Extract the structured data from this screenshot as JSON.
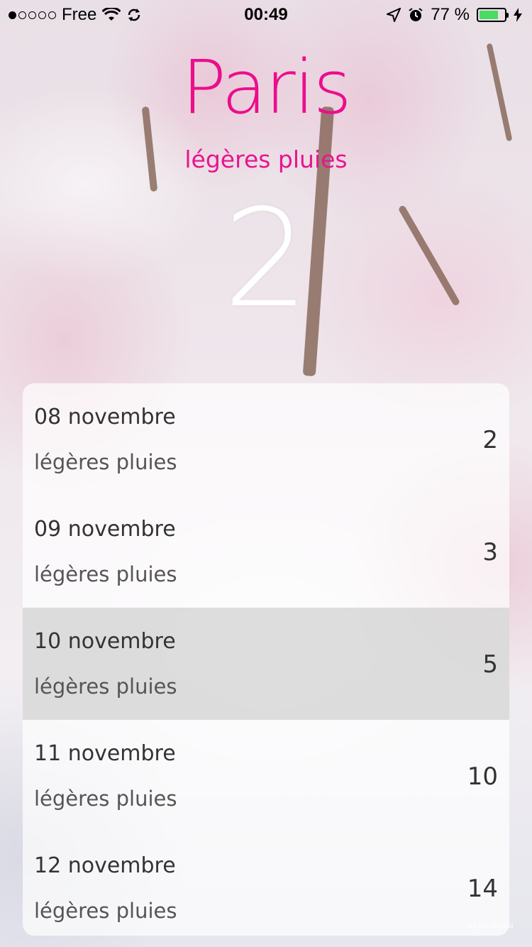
{
  "status_bar": {
    "carrier": "Free",
    "time": "00:49",
    "battery": "77 %",
    "battery_level": 0.77,
    "icons": [
      "signal-dots-icon",
      "wifi-icon",
      "sync-icon",
      "location-arrow-icon",
      "alarm-icon",
      "battery-icon",
      "charging-bolt-icon"
    ]
  },
  "header": {
    "city": "Paris",
    "condition": "légères pluies",
    "current_temp": "2"
  },
  "forecast": [
    {
      "date": "08 novembre",
      "condition": "légères pluies",
      "temp": "2"
    },
    {
      "date": "09 novembre",
      "condition": "légères pluies",
      "temp": "3"
    },
    {
      "date": "10 novembre",
      "condition": "légères pluies",
      "temp": "5"
    },
    {
      "date": "11 novembre",
      "condition": "légères pluies",
      "temp": "10"
    },
    {
      "date": "12 novembre",
      "condition": "légères pluies",
      "temp": "14"
    }
  ],
  "watermark": "Sky - Genta",
  "colors": {
    "accent": "#ec0d8c",
    "battery": "#4cd964"
  }
}
